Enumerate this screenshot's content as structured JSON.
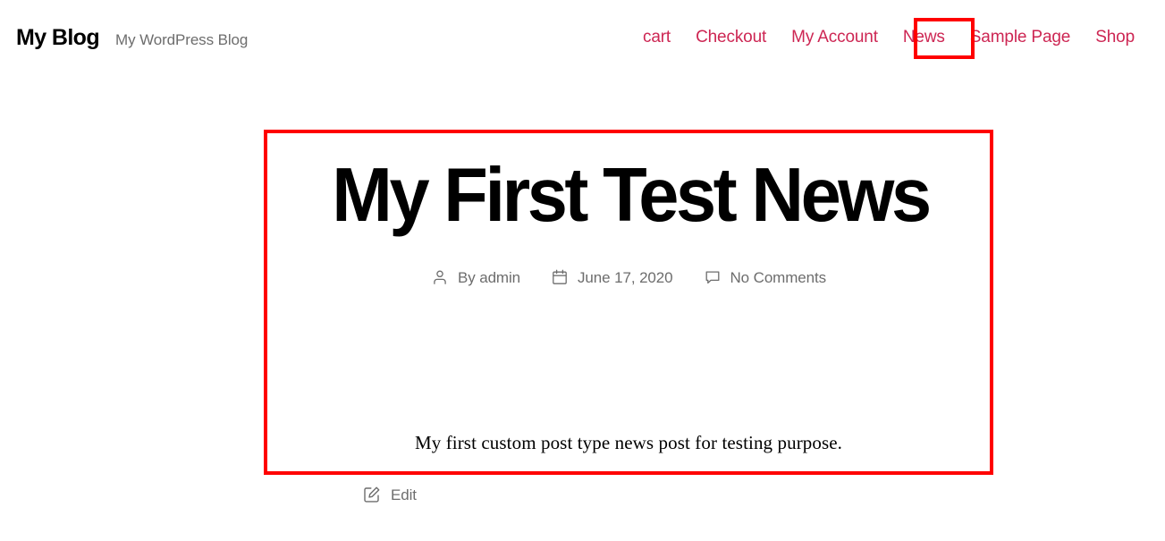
{
  "header": {
    "site_title": "My Blog",
    "tagline": "My WordPress Blog",
    "accent_color": "#cd2653",
    "highlight_color": "#ff0000",
    "nav": [
      {
        "label": "cart",
        "highlighted": false
      },
      {
        "label": "Checkout",
        "highlighted": false
      },
      {
        "label": "My Account",
        "highlighted": false
      },
      {
        "label": "News",
        "highlighted": true
      },
      {
        "label": "Sample Page",
        "highlighted": false
      },
      {
        "label": "Shop",
        "highlighted": false
      }
    ]
  },
  "article": {
    "title": "My First Test News",
    "meta": {
      "author_icon": "person-icon",
      "author": "By admin",
      "date_icon": "calendar-icon",
      "date": "June 17, 2020",
      "comments_icon": "comment-icon",
      "comments": "No Comments"
    },
    "body": "My first custom post type news post for testing purpose.",
    "highlighted": true
  },
  "edit": {
    "icon": "pencil-square-icon",
    "label": "Edit"
  }
}
